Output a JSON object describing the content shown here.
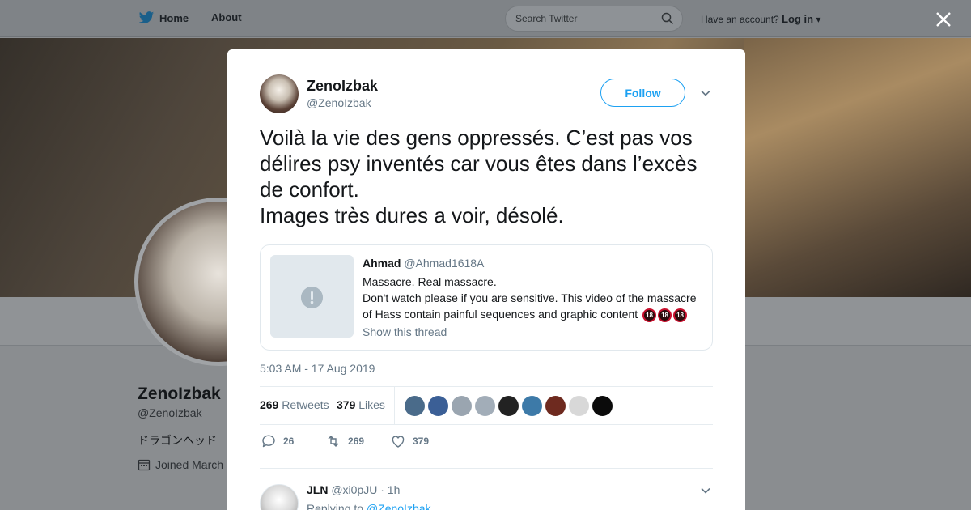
{
  "topbar": {
    "home_label": "Home",
    "about_label": "About",
    "search_placeholder": "Search Twitter",
    "account_prompt": "Have an account?",
    "login_label": "Log in"
  },
  "profile": {
    "name": "ZenoIzbak",
    "handle": "@ZenoIzbak",
    "bio": "ドラゴンヘッド",
    "joined": "Joined March"
  },
  "tweet": {
    "author_name": "ZenoIzbak",
    "author_handle": "@ZenoIzbak",
    "follow_label": "Follow",
    "text": "Voilà la vie des gens oppressés. C’est pas vos délires psy inventés car vous êtes dans l’excès de confort.\nImages très dures a voir, désolé.",
    "timestamp": "5:03 AM - 17 Aug 2019",
    "retweets_count": "269",
    "retweets_label": "Retweets",
    "likes_count": "379",
    "likes_label": "Likes",
    "reply_count": "26",
    "retweet_action_count": "269",
    "like_action_count": "379",
    "liker_colors": [
      "#4a6b8a",
      "#3b5f96",
      "#9aa5b0",
      "#a2adb8",
      "#222222",
      "#3d7aa8",
      "#6e2a1f",
      "#d8d8d8",
      "#0b0b0b"
    ]
  },
  "quote": {
    "author_name": "Ahmad",
    "author_handle": "@Ahmad1618A",
    "line1": "Massacre. Real massacre.",
    "line2": "Don't watch please if you are sensitive. This video of the massacre of Hass contain painful sequences and graphic content",
    "badge_text": "18",
    "thread_link": "Show this thread"
  },
  "reply": {
    "name": "JLN",
    "handle": "@xi0pJU",
    "time": "· 1h",
    "replying_prefix": "Replying to",
    "replying_handle": "@ZenoIzbak"
  }
}
